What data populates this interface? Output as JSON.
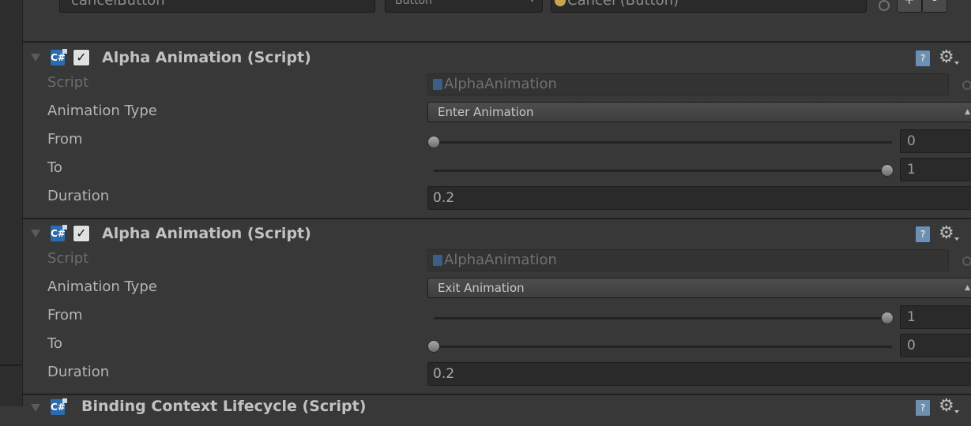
{
  "top_row": {
    "field_name_value": "cancelButton",
    "type_value": "Button",
    "object_value": "Cancel (Button)",
    "plus_label": "+",
    "minus_label": "-"
  },
  "components": [
    {
      "title": "Alpha Animation (Script)",
      "enabled": true,
      "script_label": "Script",
      "script_value": "AlphaAnimation",
      "animation_type_label": "Animation Type",
      "animation_type_value": "Enter Animation",
      "from_label": "From",
      "from_value": "0",
      "from_level": 0,
      "to_label": "To",
      "to_value": "1",
      "to_level": 1,
      "duration_label": "Duration",
      "duration_value": "0.2"
    },
    {
      "title": "Alpha Animation (Script)",
      "enabled": true,
      "script_label": "Script",
      "script_value": "AlphaAnimation",
      "animation_type_label": "Animation Type",
      "animation_type_value": "Exit Animation",
      "from_label": "From",
      "from_value": "1",
      "from_level": 1,
      "to_label": "To",
      "to_value": "0",
      "to_level": 0,
      "duration_label": "Duration",
      "duration_value": "0.2"
    }
  ],
  "bottom_component": {
    "title": "Binding Context Lifecycle (Script)"
  },
  "icons": {
    "cs_script": "csharp-script-icon",
    "help": "help-icon",
    "gear": "gear-icon",
    "checkmark": "✓"
  },
  "colors": {
    "background": "#383838",
    "field_background": "#2a2a2a",
    "script_icon": "#2b6cae"
  }
}
